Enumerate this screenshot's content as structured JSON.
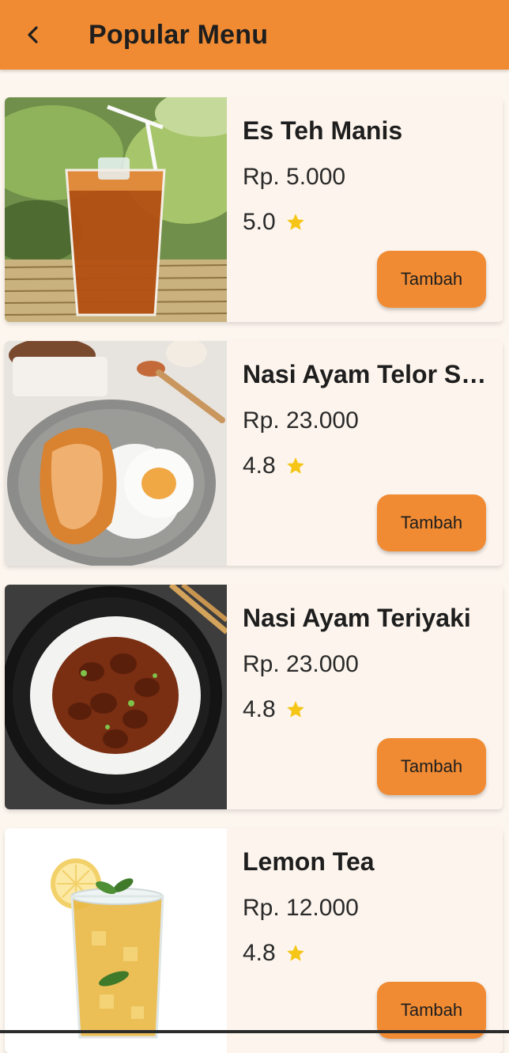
{
  "header": {
    "title": "Popular Menu",
    "back_icon": "chevron-left-icon"
  },
  "colors": {
    "accent": "#f08b33",
    "background": "#fdf6ef",
    "star": "#f5c518"
  },
  "menu": [
    {
      "name": "Es Teh Manis",
      "price": "Rp. 5.000",
      "rating": "5.0",
      "button": "Tambah"
    },
    {
      "name": "Nasi Ayam Telor Sambal Matah",
      "price": "Rp. 23.000",
      "rating": "4.8",
      "button": "Tambah"
    },
    {
      "name": "Nasi Ayam Teriyaki",
      "price": "Rp. 23.000",
      "rating": "4.8",
      "button": "Tambah"
    },
    {
      "name": "Lemon Tea",
      "price": "Rp. 12.000",
      "rating": "4.8",
      "button": "Tambah"
    }
  ]
}
